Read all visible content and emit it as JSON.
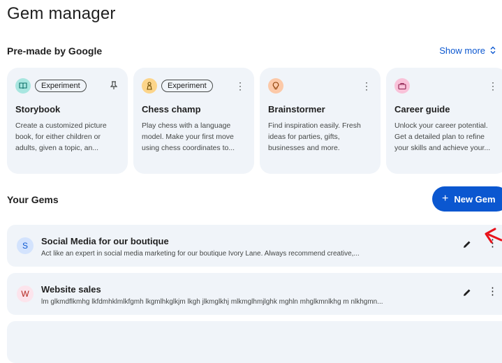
{
  "page": {
    "title": "Gem manager"
  },
  "premade": {
    "title": "Pre-made by Google",
    "show_more": "Show more",
    "cards": [
      {
        "title": "Storybook",
        "badge": "Experiment",
        "description": "Create a customized picture book, for either children or adults, given a topic, an...",
        "icon": "book-icon",
        "icon_bg": "#a8e6e0"
      },
      {
        "title": "Chess champ",
        "badge": "Experiment",
        "description": "Play chess with a language model. Make your first move using chess coordinates to...",
        "icon": "chess-pawn-icon",
        "icon_bg": "#fcd58a"
      },
      {
        "title": "Brainstormer",
        "description": "Find inspiration easily. Fresh ideas for parties, gifts, businesses and more.",
        "icon": "lightbulb-icon",
        "icon_bg": "#fcc9a8"
      },
      {
        "title": "Career guide",
        "description": "Unlock your career potential. Get a detailed plan to refine your skills and achieve your...",
        "icon": "briefcase-icon",
        "icon_bg": "#f9c2d9"
      }
    ]
  },
  "your_gems": {
    "title": "Your Gems",
    "new_gem_label": "New Gem",
    "items": [
      {
        "initial": "S",
        "name": "Social Media for our boutique",
        "description": "Act like an expert in social media marketing for our boutique Ivory Lane. Always recommend creative,...",
        "avatar_bg": "#d3e3fd",
        "avatar_color": "#0b57d0"
      },
      {
        "initial": "W",
        "name": "Website sales",
        "description": "lm glkmdflkmhg lkfdmhklmlkfgmh lkgmlhkglkjm lkgh jlkmglkhj mlkmglhmjlghk mghln mhglkmnlkhg m nlkhgmn...",
        "avatar_bg": "#fce4ec",
        "avatar_color": "#b3261e"
      }
    ]
  },
  "colors": {
    "accent": "#0b57d0",
    "card_bg": "#f0f4f9",
    "annotation_arrow": "#e8131b"
  }
}
